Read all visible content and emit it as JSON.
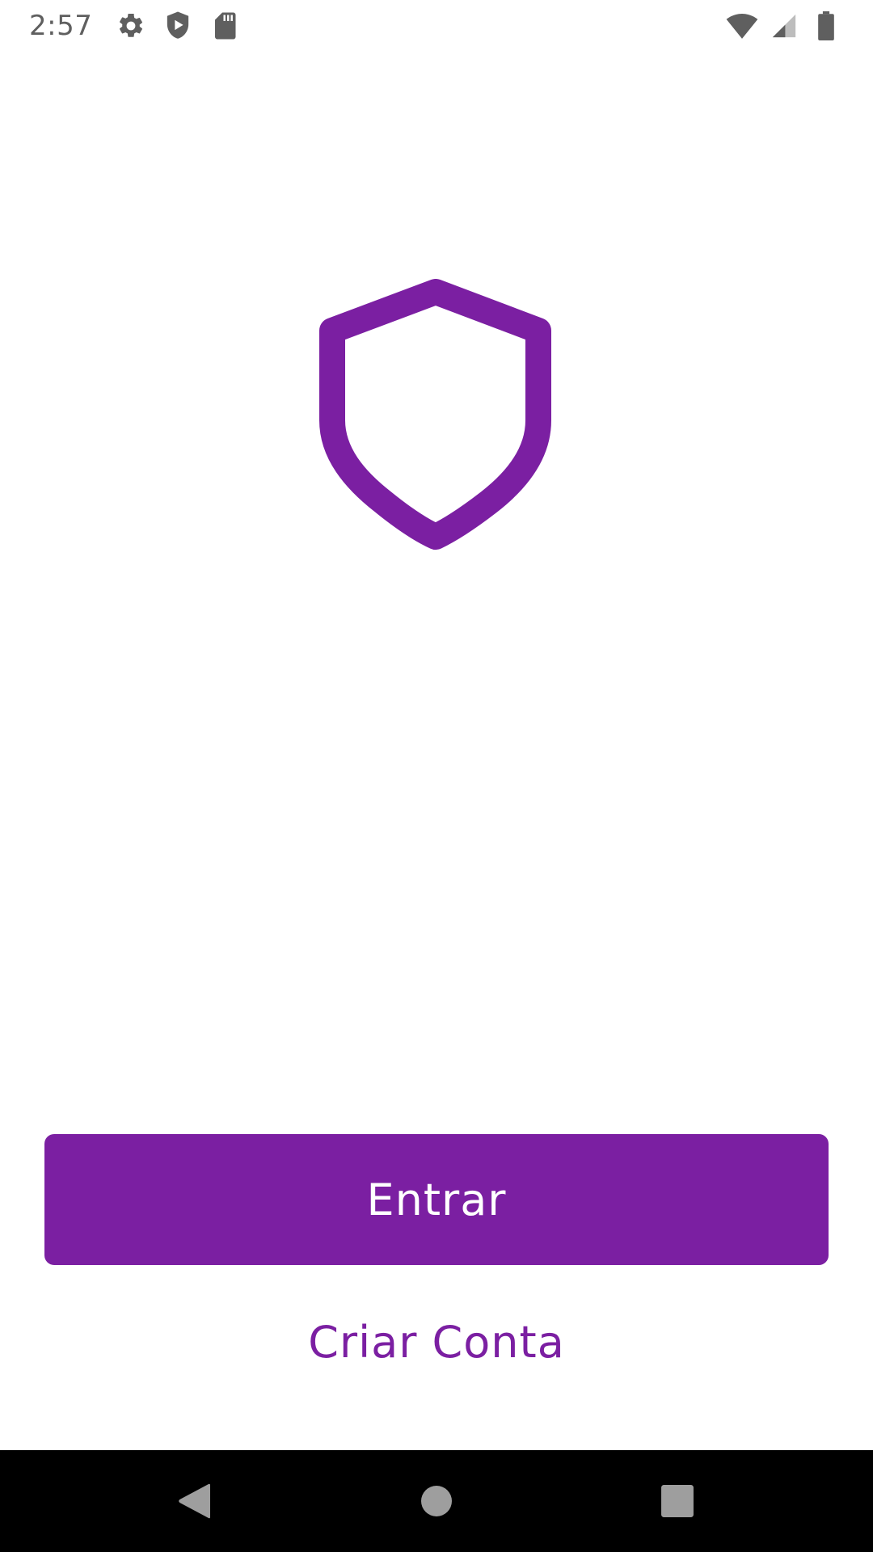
{
  "status_bar": {
    "time": "2:57",
    "left_icons": [
      "gear-icon",
      "shield-play-icon",
      "sd-card-icon"
    ],
    "right_icons": [
      "wifi-icon",
      "cell-signal-icon",
      "battery-icon"
    ],
    "icon_color": "#5f5f5f"
  },
  "logo": {
    "icon": "shield-icon",
    "color": "#7b1fa2"
  },
  "actions": {
    "primary_label": "Entrar",
    "secondary_label": "Criar Conta",
    "accent_color": "#7b1fa2"
  },
  "nav_bar": {
    "buttons": [
      "back-icon",
      "home-icon",
      "recents-icon"
    ],
    "background": "#000000",
    "icon_color": "#9e9e9e"
  }
}
